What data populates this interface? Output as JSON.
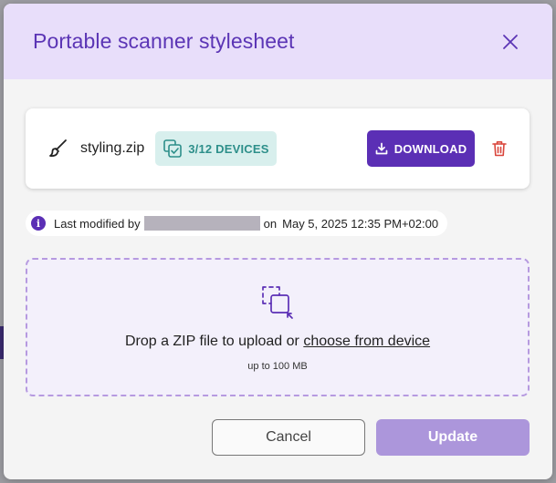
{
  "dialog": {
    "title": "Portable scanner stylesheet",
    "close_icon": "close-icon"
  },
  "file": {
    "icon": "paintbrush-icon",
    "name": "styling.zip",
    "devices_label": "3/12 DEVICES",
    "devices_icon": "copy-check-icon",
    "download_label": "DOWNLOAD",
    "download_icon": "download-icon",
    "delete_icon": "trash-icon"
  },
  "modified": {
    "prefix": "Last modified by",
    "on": "on",
    "timestamp": "May 5, 2025 12:35 PM+02:00"
  },
  "dropzone": {
    "icon": "drag-drop-icon",
    "text": "Drop a ZIP file to upload or",
    "link": "choose from device",
    "limit": "up to 100 MB"
  },
  "footer": {
    "cancel_label": "Cancel",
    "update_label": "Update"
  },
  "colors": {
    "accent": "#5b2fb5",
    "header_bg": "#e8defa",
    "badge_bg": "#d8efed",
    "badge_text": "#2d8f8a",
    "delete": "#d9453b",
    "update_disabled": "#ac96db"
  }
}
